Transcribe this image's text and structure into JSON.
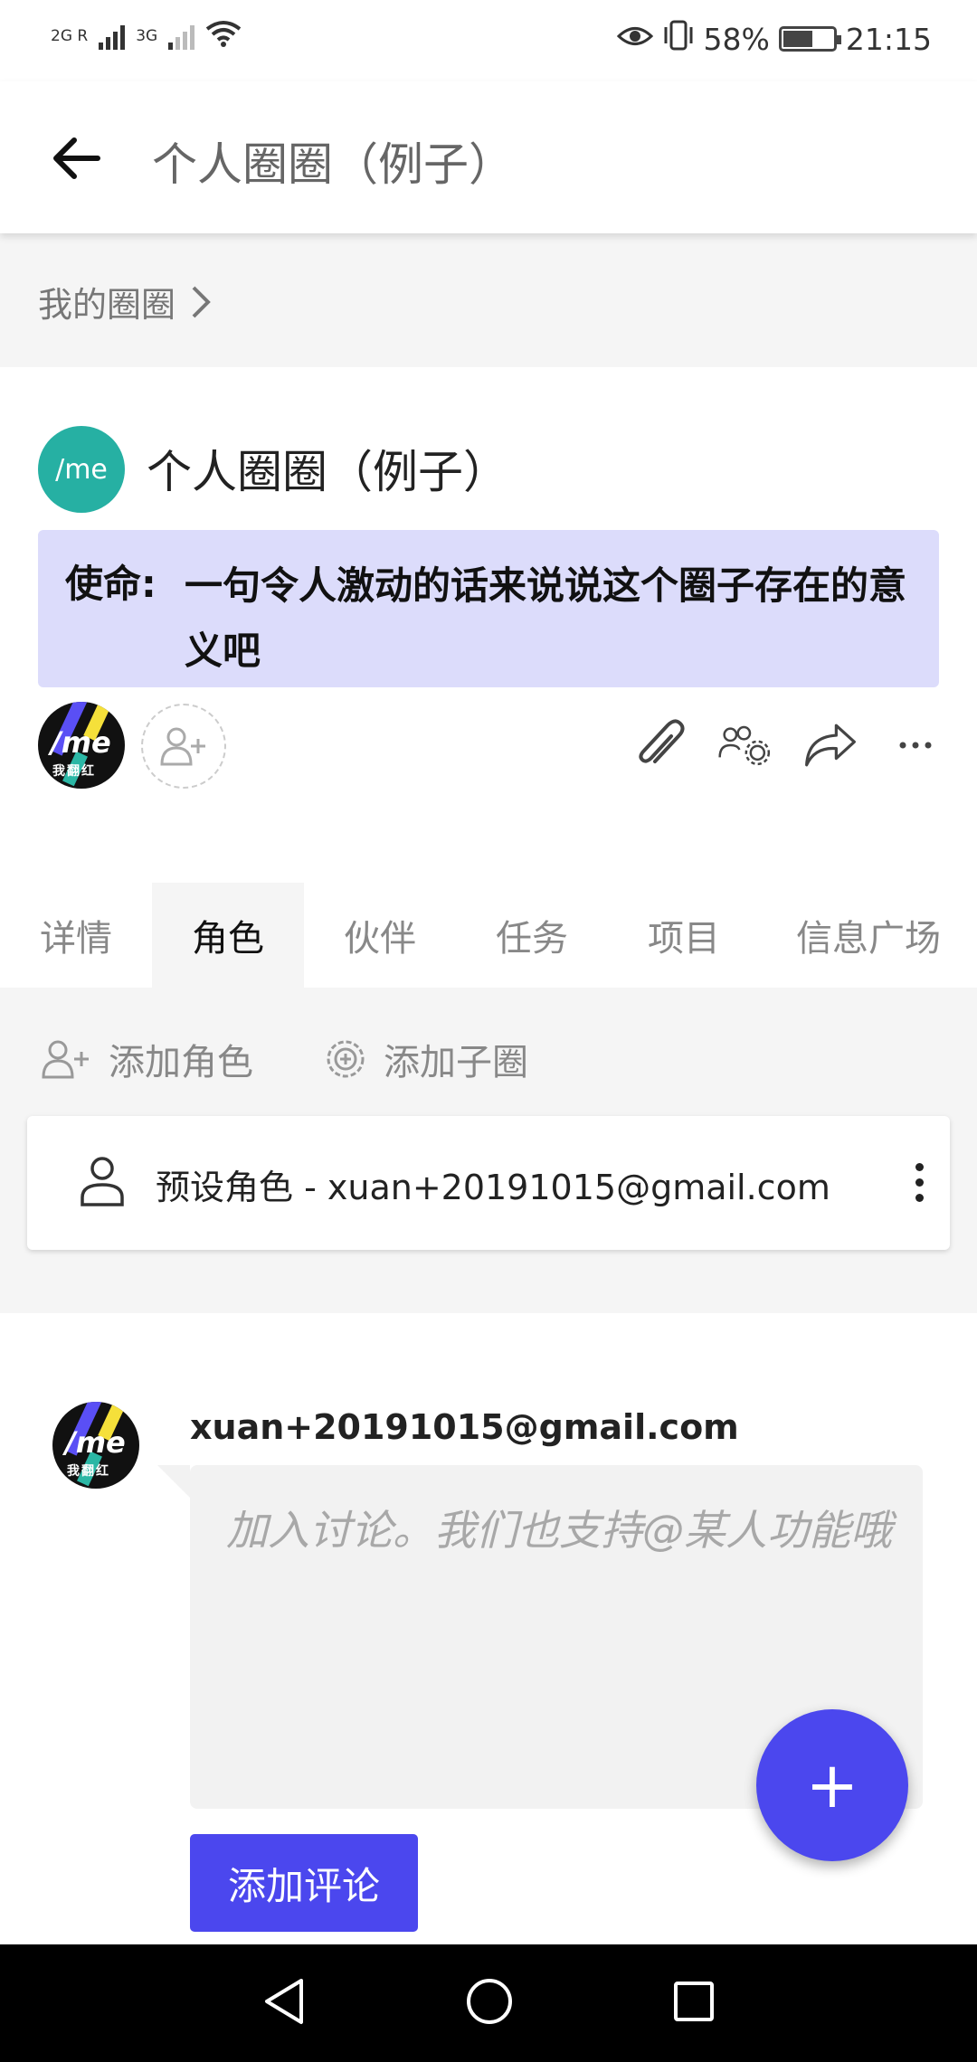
{
  "status_bar": {
    "signal1_label": "2G R",
    "signal2_label": "3G",
    "battery_text": "58%",
    "battery_level": 0.58,
    "time": "21:15"
  },
  "app_bar": {
    "title": "个人圈圈（例子）"
  },
  "breadcrumb": {
    "label": "我的圈圈"
  },
  "circle": {
    "logo_text": "/me",
    "title": "个人圈圈（例子）",
    "mission_label": "使命:",
    "mission_text": "一句令人激动的话来说说这个圈子存在的意义吧",
    "avatar_text": "/me",
    "avatar_subtext": "我翻红"
  },
  "tabs": [
    {
      "label": "详情"
    },
    {
      "label": "角色"
    },
    {
      "label": "伙伴"
    },
    {
      "label": "任务"
    },
    {
      "label": "项目"
    },
    {
      "label": "信息广场"
    }
  ],
  "active_tab": "角色",
  "roles": {
    "add_role_label": "添加角色",
    "add_subcircle_label": "添加子圈",
    "items": [
      {
        "label": "预设角色 - xuan+20191015@gmail.com"
      }
    ]
  },
  "comment": {
    "username": "xuan+20191015@gmail.com",
    "placeholder": "加入讨论。我们也支持@某人功能哦",
    "submit_label": "添加评论"
  },
  "fab": {
    "label": "+"
  },
  "colors": {
    "accent": "#4b47ee",
    "teal": "#26b0a3",
    "mission_bg": "#dcdcfb"
  }
}
